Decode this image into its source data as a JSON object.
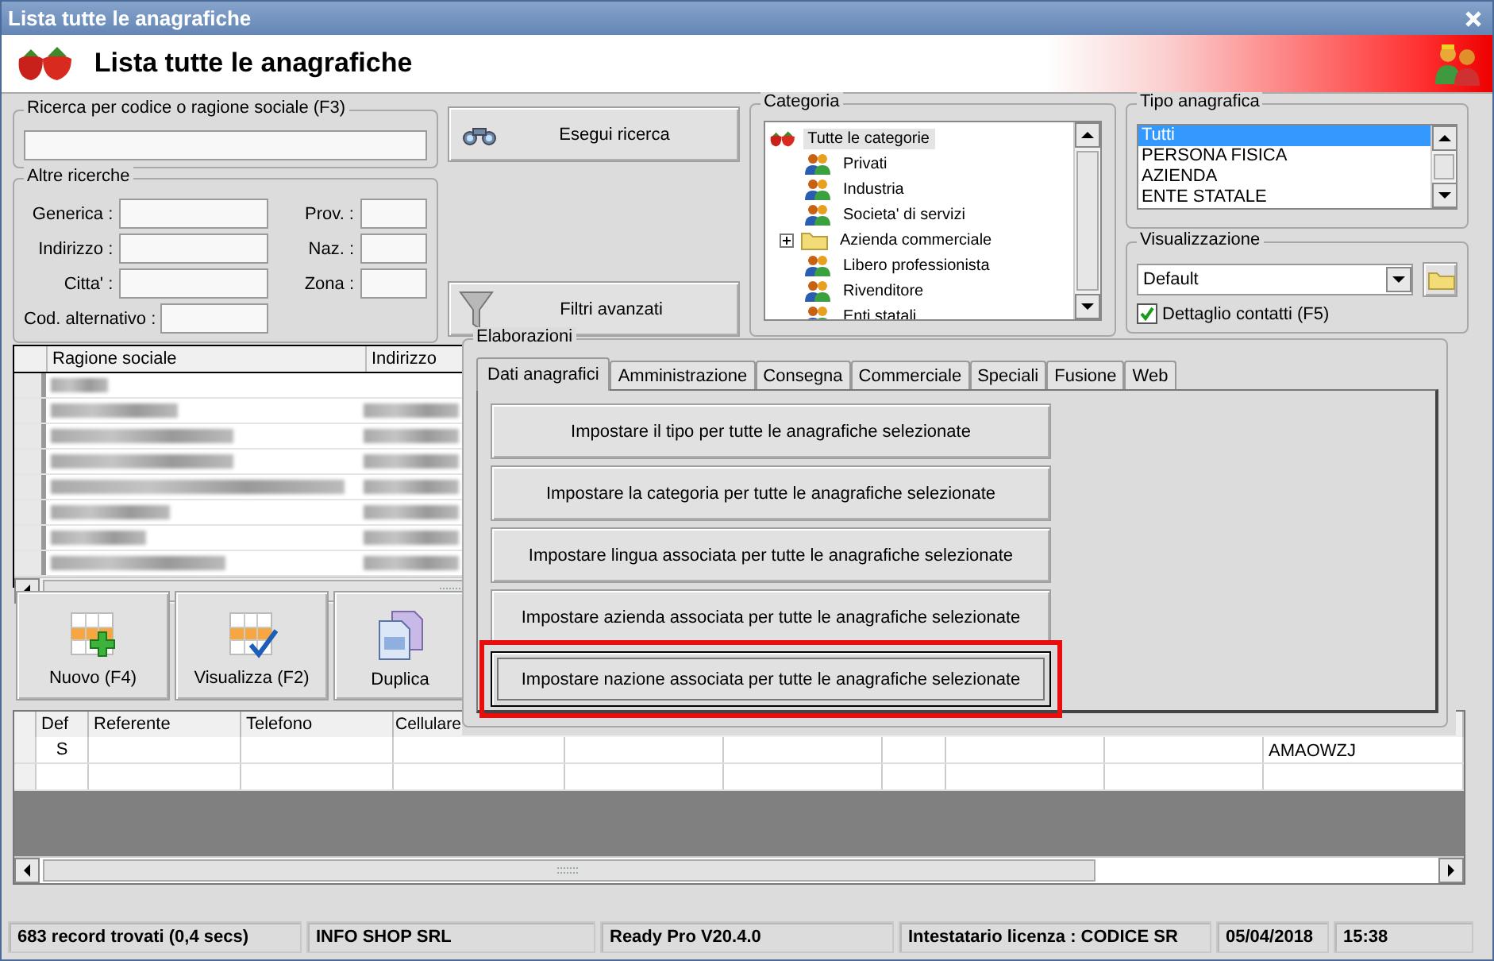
{
  "window": {
    "title": "Lista tutte le anagrafiche"
  },
  "header": {
    "title": "Lista tutte le anagrafiche"
  },
  "search": {
    "title": "Ricerca per codice o ragione sociale (F3)",
    "button": "Esegui ricerca"
  },
  "other_searches": {
    "title": "Altre ricerche",
    "left_fields": [
      {
        "label": "Generica :"
      },
      {
        "label": "Indirizzo :"
      },
      {
        "label": "Citta' :"
      },
      {
        "label": "Cod. alternativo :"
      }
    ],
    "right_fields": [
      {
        "label": "Prov. :"
      },
      {
        "label": "Naz. :"
      },
      {
        "label": "Zona :"
      }
    ]
  },
  "advanced_filters": {
    "button": "Filtri avanzati"
  },
  "category": {
    "title": "Categoria",
    "tree": [
      {
        "label": "Tutte le categorie",
        "kind": "root",
        "selected": true,
        "children": [
          {
            "label": "Privati",
            "kind": "group",
            "selected": false
          },
          {
            "label": "Industria",
            "kind": "group",
            "selected": false
          },
          {
            "label": "Societa' di servizi",
            "kind": "group",
            "selected": false
          },
          {
            "label": "Azienda commerciale",
            "kind": "folder",
            "selected": false
          },
          {
            "label": "Libero professionista",
            "kind": "group",
            "selected": false
          },
          {
            "label": "Rivenditore",
            "kind": "group",
            "selected": false
          },
          {
            "label": "Enti statali",
            "kind": "group",
            "selected": false
          }
        ]
      }
    ]
  },
  "registry_type": {
    "title": "Tipo anagrafica",
    "items": [
      {
        "label": "Tutti",
        "selected": true
      },
      {
        "label": "PERSONA FISICA",
        "selected": false
      },
      {
        "label": "AZIENDA",
        "selected": false
      },
      {
        "label": "ENTE STATALE",
        "selected": false
      }
    ]
  },
  "view": {
    "title": "Visualizzazione",
    "value": "Default",
    "contact_detail": {
      "label": "Dettaglio contatti (F5)",
      "checked": true
    }
  },
  "grid": {
    "columns": [
      "Ragione sociale",
      "Indirizzo"
    ]
  },
  "actions": [
    {
      "label": "Nuovo (F4)",
      "kind": "new"
    },
    {
      "label": "Visualizza (F2)",
      "kind": "view"
    },
    {
      "label": "Duplica",
      "kind": "duplicate"
    }
  ],
  "processing": {
    "title": "Elaborazioni",
    "tabs": [
      {
        "label": "Dati anagrafici",
        "selected": true
      },
      {
        "label": "Amministrazione",
        "selected": false
      },
      {
        "label": "Consegna",
        "selected": false
      },
      {
        "label": "Commerciale",
        "selected": false
      },
      {
        "label": "Speciali",
        "selected": false
      },
      {
        "label": "Fusione",
        "selected": false
      },
      {
        "label": "Web",
        "selected": false
      }
    ],
    "buttons": [
      {
        "label": "Impostare il tipo per tutte le anagrafiche selezionate",
        "highlighted": false
      },
      {
        "label": "Impostare la categoria per tutte le anagrafiche selezionate",
        "highlighted": false
      },
      {
        "label": "Impostare lingua associata per tutte le anagrafiche selezionate",
        "highlighted": false
      },
      {
        "label": "Impostare azienda associata per tutte le anagrafiche selezionate",
        "highlighted": false
      },
      {
        "label": "Impostare nazione associata per tutte le anagrafiche selezionate",
        "highlighted": true
      }
    ]
  },
  "contacts": {
    "columns": [
      "Def",
      "Referente",
      "Telefono",
      "Cellulare"
    ],
    "rows": [
      {
        "def": "S",
        "column_10": "AMAOWZJ"
      }
    ]
  },
  "status_bar": [
    "683 record trovati (0,4 secs)",
    "INFO SHOP SRL",
    "Ready Pro V20.4.0",
    "Intestatario licenza : CODICE SR",
    "05/04/2018",
    "15:38"
  ]
}
